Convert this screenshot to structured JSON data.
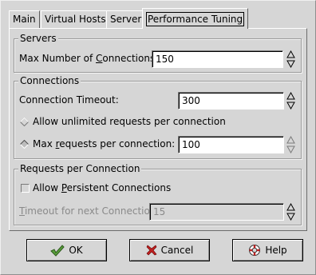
{
  "tabs": [
    {
      "label": "Main"
    },
    {
      "label": "Virtual Hosts"
    },
    {
      "label": "Server"
    },
    {
      "label": "Performance Tuning"
    }
  ],
  "active_tab": "Performance Tuning",
  "servers": {
    "heading": "Servers",
    "max_connections_label": "Max Number of Connections:",
    "max_connections_value": "150"
  },
  "connections": {
    "heading": "Connections",
    "timeout_label": "Connection Timeout:",
    "timeout_value": "300",
    "unlimited_label": "Allow unlimited requests per connection",
    "max_requests_label": "Max requests per connection:",
    "max_requests_value": "100",
    "selected_option": "max_requests"
  },
  "requests": {
    "heading": "Requests per Connection",
    "persistent_label": "Allow Persistent Connections",
    "persistent_checked": false,
    "timeout_next_label": "Timeout for next Connection:",
    "timeout_next_value": "15"
  },
  "buttons": {
    "ok": "OK",
    "cancel": "Cancel",
    "help": "Help"
  },
  "icons": {
    "ok": "check-icon",
    "cancel": "x-icon",
    "help": "lifebuoy-icon"
  },
  "colors": {
    "background": "#d6d6d6",
    "ok_icon": "#5aa03c",
    "cancel_icon": "#c02020"
  }
}
